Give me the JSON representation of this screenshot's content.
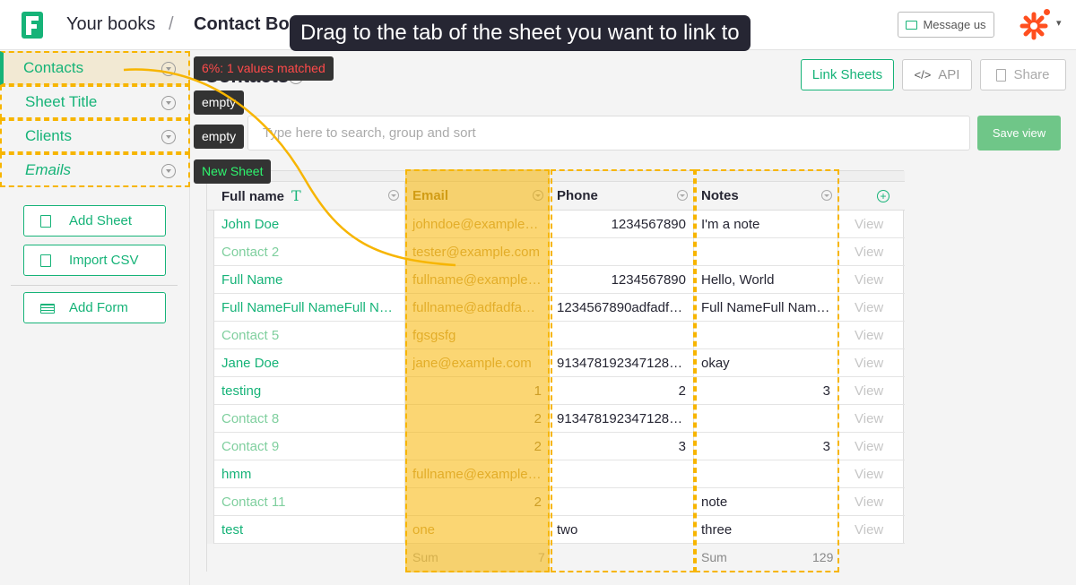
{
  "header": {
    "breadcrumb_root": "Your books",
    "breadcrumb_sep": "/",
    "document_title": "Contact Book",
    "tooltip": "Drag to the tab of the sheet you want to link to",
    "message_button": "Message us",
    "avatar_icon": "zapier-asterisk-icon",
    "accent_color": "#16b378"
  },
  "sidebar": {
    "pages": [
      {
        "label": "Contacts",
        "active": true
      },
      {
        "label": "Sheet Title"
      },
      {
        "label": "Clients"
      },
      {
        "label": "Emails",
        "italic": true
      }
    ],
    "tags": [
      {
        "text": "6%: 1 values matched",
        "color": "red"
      },
      {
        "text": "empty",
        "color": "white"
      },
      {
        "text": "empty",
        "color": "white"
      },
      {
        "text": "New Sheet",
        "color": "green"
      }
    ],
    "buttons": {
      "add_sheet": "Add Sheet",
      "import_csv": "Import CSV",
      "add_form": "Add Form"
    }
  },
  "main": {
    "section_title": "Contacts",
    "help": "?",
    "link_sheets": "Link Sheets",
    "api": "API",
    "share": "Share",
    "search_placeholder": "Type here to search, group and sort",
    "save_view": "Save view"
  },
  "table": {
    "columns": [
      "Full name",
      "Email",
      "Phone",
      "Notes"
    ],
    "type_icon": "T",
    "view_label": "View",
    "rows": [
      {
        "name": "John Doe",
        "email": "johndoe@example.com",
        "phone": "1234567890",
        "notes": "I'm a note"
      },
      {
        "name": "Contact 2",
        "dim": true,
        "email": "tester@example.com",
        "phone": "",
        "notes": ""
      },
      {
        "name": "Full Name",
        "email": "fullname@example.com",
        "phone": "1234567890",
        "notes": "Hello, World"
      },
      {
        "name": "Full NameFull NameFull Name",
        "email": "fullname@adfadfasdf.com",
        "phone": "1234567890adfadfadf",
        "notes": "Full NameFull NameFull Name"
      },
      {
        "name": "Contact 5",
        "dim": true,
        "email": "fgsgsfg",
        "phone": "",
        "notes": ""
      },
      {
        "name": "Jane Doe",
        "email": "jane@example.com",
        "phone": "913478192347128412",
        "notes": "okay"
      },
      {
        "name": "testing",
        "email": "1",
        "phone": "2",
        "notes": "3"
      },
      {
        "name": "Contact 8",
        "dim": true,
        "email": "2",
        "phone": "913478192347128412",
        "notes": ""
      },
      {
        "name": "Contact 9",
        "dim": true,
        "email": "2",
        "phone": "3",
        "notes": "3"
      },
      {
        "name": "hmm",
        "email": "fullname@example.com",
        "phone": "",
        "notes": ""
      },
      {
        "name": "Contact 11",
        "dim": true,
        "email": "2",
        "phone": "",
        "notes": "note"
      },
      {
        "name": "test",
        "email": "one",
        "phone": "two",
        "notes": "three"
      }
    ],
    "sum_row": {
      "email_label": "Sum",
      "email_value": "7",
      "notes_label": "Sum",
      "notes_value": "129"
    }
  }
}
